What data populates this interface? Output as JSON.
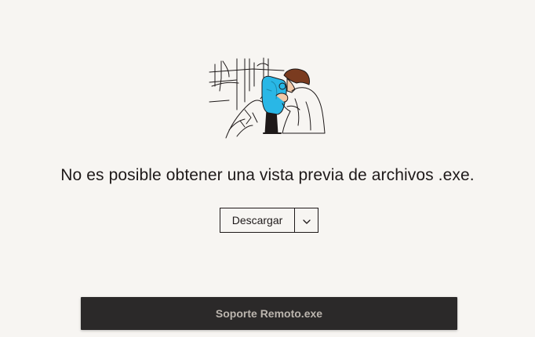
{
  "preview": {
    "message": "No es posible obtener una vista previa de archivos .exe."
  },
  "download": {
    "label": "Descargar",
    "dropdown_icon": "chevron-down-icon"
  },
  "file_bar": {
    "filename": "Soporte Remoto.exe"
  },
  "illustration": {
    "icon": "binoculars-viewer-illustration",
    "accent_color": "#29b7e6"
  },
  "colors": {
    "background": "#f7f5f2",
    "text": "#1e1919",
    "file_bar": "#2b2929"
  }
}
